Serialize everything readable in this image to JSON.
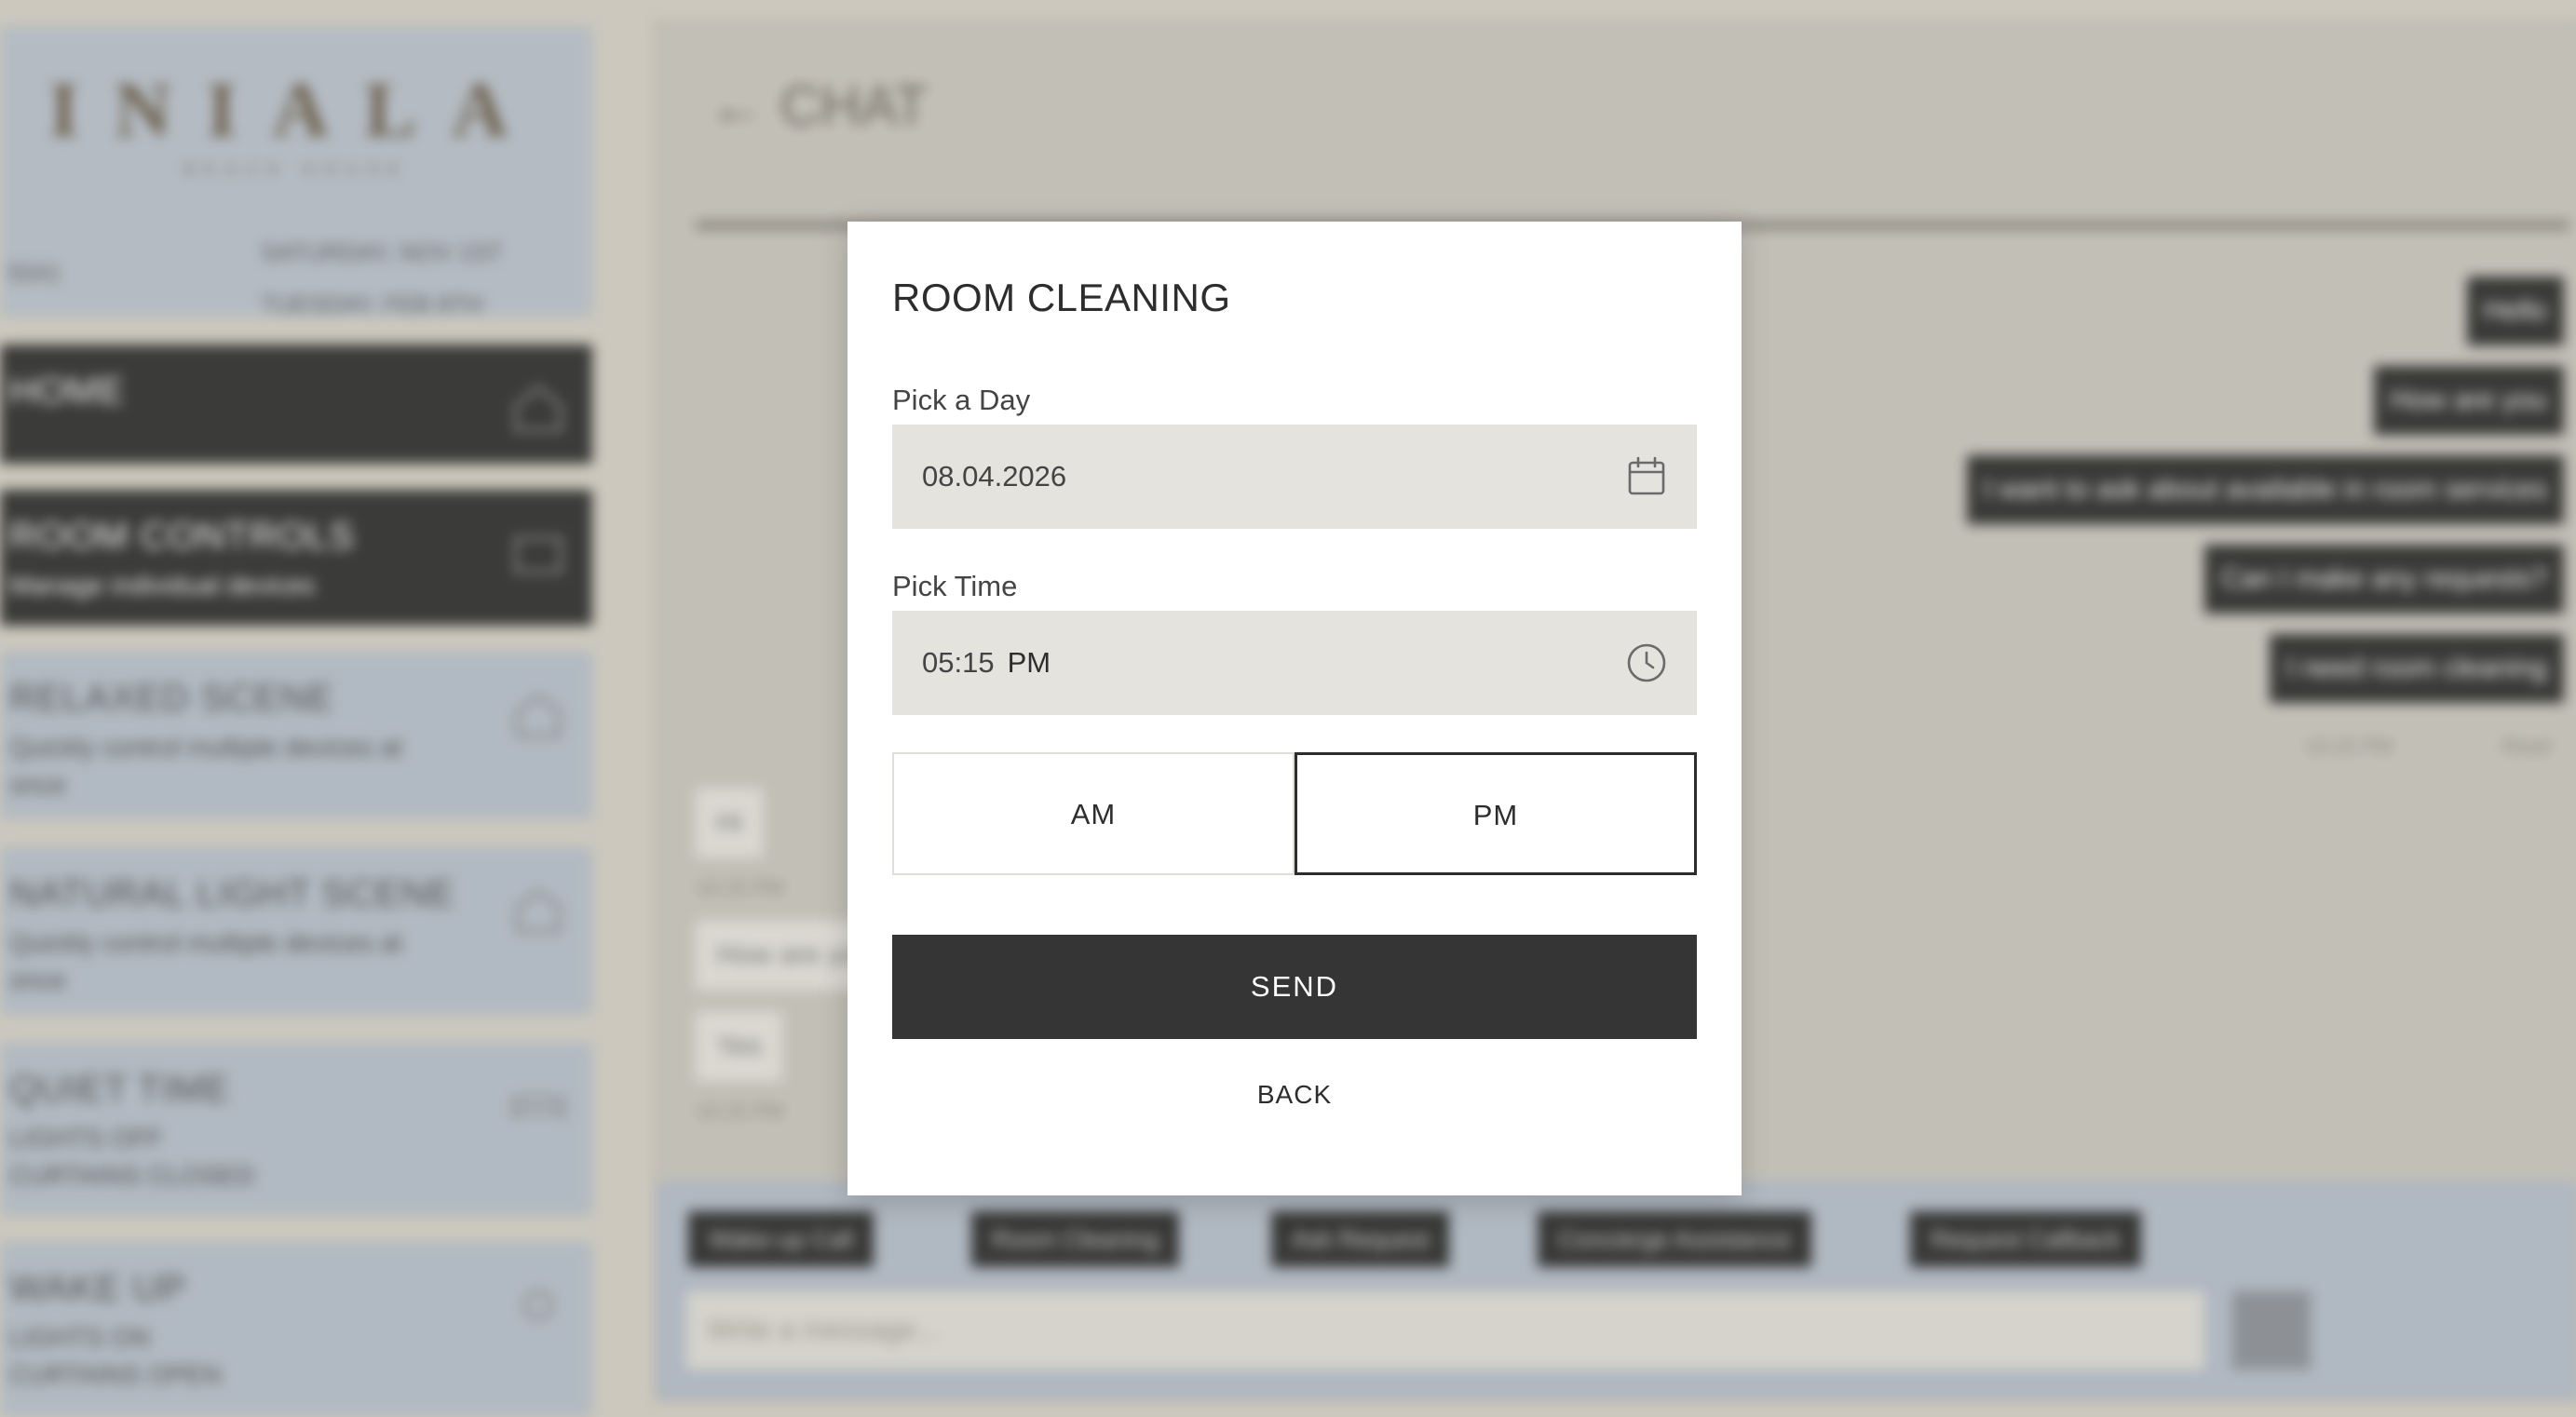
{
  "background": {
    "brand": {
      "logo": "INIALA",
      "tagline": "BEACH HOUSE"
    },
    "room_label": "5041",
    "checkin": "SATURDAY, NOV 1ST",
    "checkout": "TUESDAY, FEB 8TH",
    "menu": [
      {
        "title": "HOME",
        "subtitle": "",
        "icon": "home-icon",
        "style": "dark"
      },
      {
        "title": "ROOM CONTROLS",
        "subtitle": "Manage individual devices",
        "icon": "controls-icon",
        "style": "dark"
      },
      {
        "title": "RELAXED SCENE",
        "subtitle": "Quickly control multiple devices at once",
        "icon": "scene-icon",
        "style": "light"
      },
      {
        "title": "NATURAL LIGHT SCENE",
        "subtitle": "Quickly control multiple devices at once",
        "icon": "scene-icon",
        "style": "light"
      },
      {
        "title": "QUIET TIME",
        "subtitle": "LIGHTS OFF\nCURTAINS CLOSED",
        "icon": "bed-icon",
        "style": "light"
      },
      {
        "title": "WAKE UP",
        "subtitle": "LIGHTS ON\nCURTAINS OPEN",
        "icon": "sun-icon",
        "style": "light"
      }
    ],
    "chat": {
      "title": "CHAT",
      "outgoing": [
        "Hello",
        "How are you",
        "I want to ask about available in room services",
        "Can I make any requests?",
        "I need room cleaning"
      ],
      "outgoing_time": "10:15 PM",
      "outgoing_status": "Read",
      "incoming": [
        {
          "text": "Hi",
          "time": "10:15 PM"
        },
        {
          "text": "How are you",
          "time": ""
        },
        {
          "text": "Yes",
          "time": "10:15 PM"
        }
      ],
      "quick_actions": [
        "Wake-up Call",
        "Room Cleaning",
        "Ask Request",
        "Concierge Assistance",
        "Request Callback"
      ],
      "input_placeholder": "Write a message..."
    }
  },
  "modal": {
    "title": "ROOM CLEANING",
    "day_label": "Pick a Day",
    "day_value": "08.04.2026",
    "time_label": "Pick Time",
    "time_value": "05:15",
    "time_period": "PM",
    "am_label": "AM",
    "pm_label": "PM",
    "selected_period": "PM",
    "send_label": "SEND",
    "back_label": "BACK"
  }
}
